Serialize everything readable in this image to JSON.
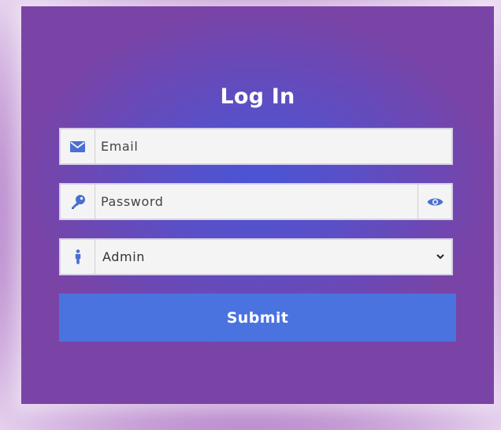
{
  "login_form": {
    "title": "Log In",
    "email": {
      "placeholder": "Email",
      "value": "",
      "icon": "envelope-icon"
    },
    "password": {
      "placeholder": "Password",
      "value": "",
      "icon": "key-icon",
      "toggle_icon": "eye-icon"
    },
    "role": {
      "selected": "Admin",
      "options": [
        "Admin"
      ],
      "icon": "person-icon"
    },
    "submit_label": "Submit"
  },
  "colors": {
    "accent": "#4a73df",
    "icon": "#4a6fd3",
    "field_bg": "#f4f4f4"
  }
}
